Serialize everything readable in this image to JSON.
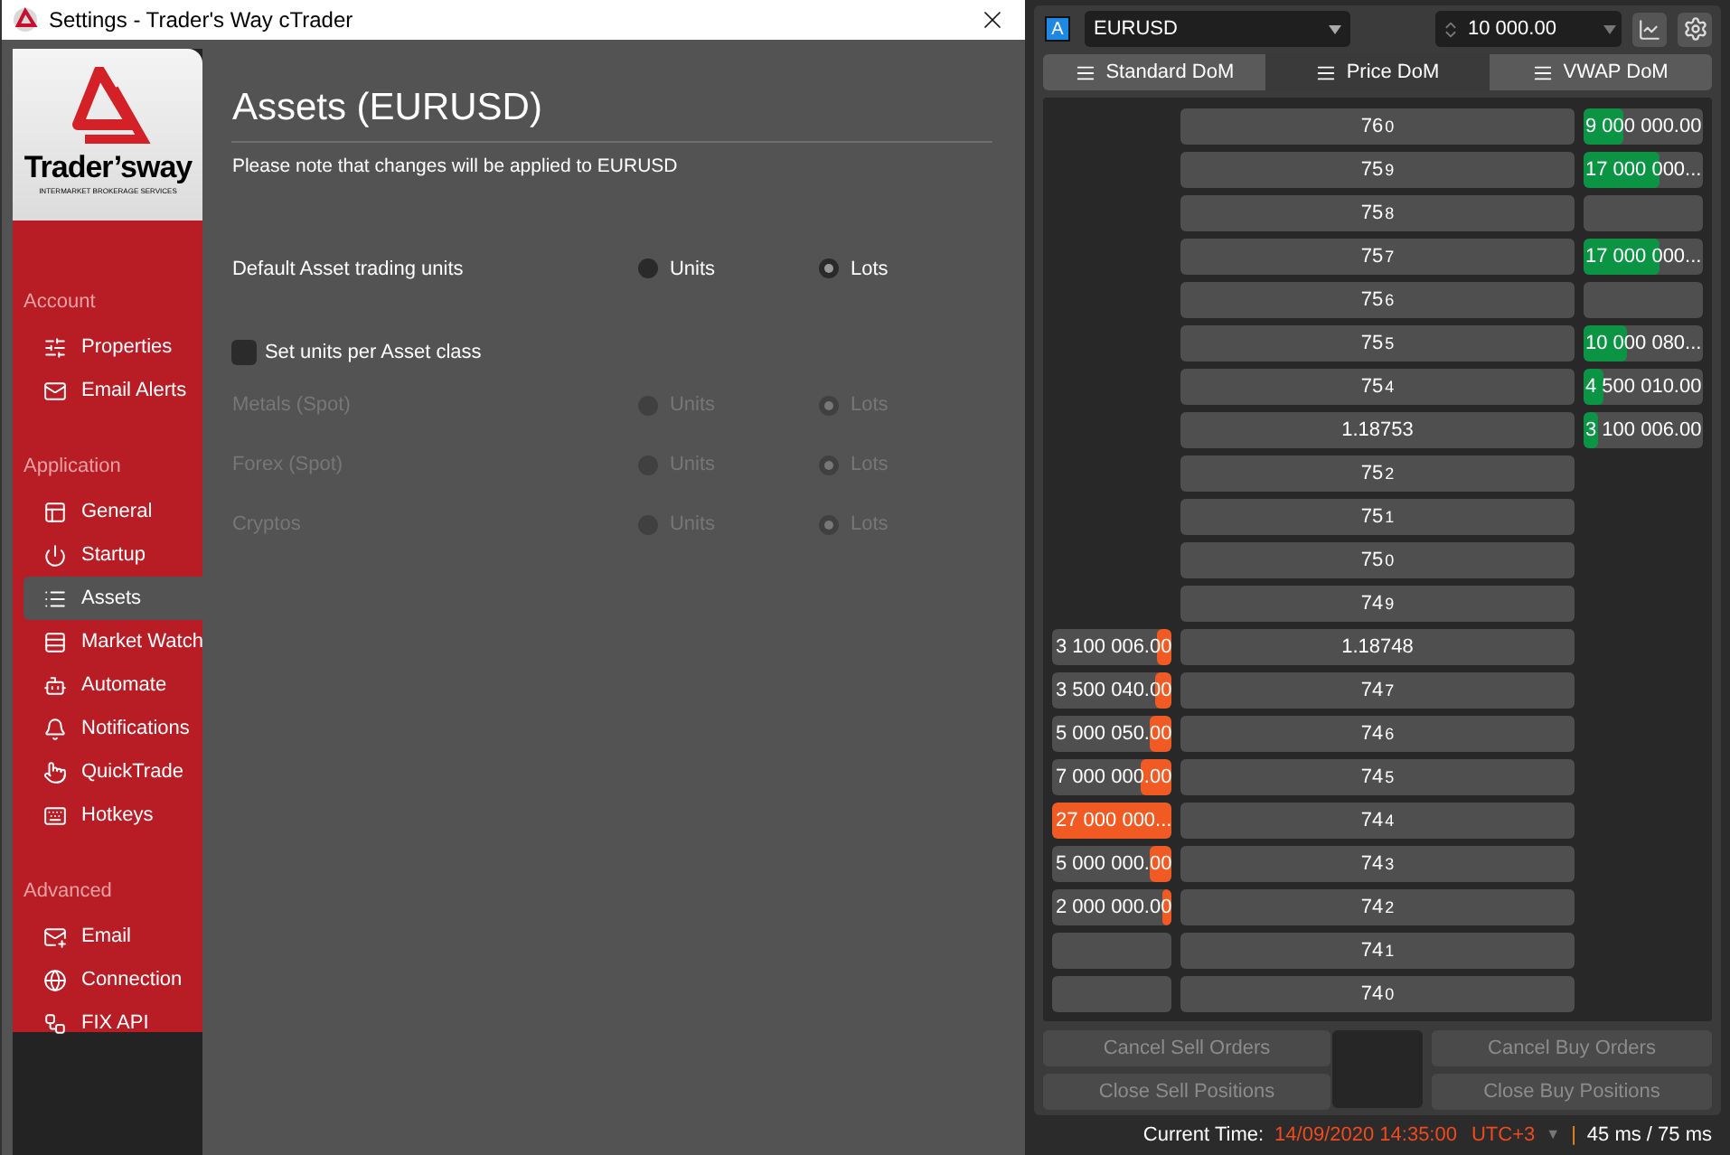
{
  "window": {
    "title": "Settings - Trader's Way cTrader"
  },
  "logo": {
    "name": "Trader’sway",
    "tagline": "INTERMARKET BROKERAGE SERVICES"
  },
  "sidebar": {
    "sections": [
      {
        "label": "Account",
        "items": [
          {
            "label": "Properties",
            "selected": false
          },
          {
            "label": "Email Alerts",
            "selected": false
          }
        ]
      },
      {
        "label": "Application",
        "items": [
          {
            "label": "General",
            "selected": false
          },
          {
            "label": "Startup",
            "selected": false
          },
          {
            "label": "Assets",
            "selected": true
          },
          {
            "label": "Market Watch",
            "selected": false
          },
          {
            "label": "Automate",
            "selected": false
          },
          {
            "label": "Notifications",
            "selected": false
          },
          {
            "label": "QuickTrade",
            "selected": false
          },
          {
            "label": "Hotkeys",
            "selected": false
          }
        ]
      },
      {
        "label": "Advanced",
        "items": [
          {
            "label": "Email",
            "selected": false
          },
          {
            "label": "Connection",
            "selected": false
          },
          {
            "label": "FIX API",
            "selected": false
          }
        ]
      }
    ]
  },
  "content": {
    "title": "Assets (EURUSD)",
    "note": "Please note that changes will be applied to EURUSD",
    "default_units": {
      "label": "Default Asset trading units",
      "disabled": false,
      "options": [
        {
          "label": "Units",
          "selected": false
        },
        {
          "label": "Lots",
          "selected": true
        }
      ]
    },
    "per_class": {
      "label": "Set units per Asset class",
      "checked": false
    },
    "classes": [
      {
        "label": "Metals (Spot)",
        "disabled": true,
        "options": [
          {
            "label": "Units",
            "selected": false
          },
          {
            "label": "Lots",
            "selected": true
          }
        ]
      },
      {
        "label": "Forex (Spot)",
        "disabled": true,
        "options": [
          {
            "label": "Units",
            "selected": false
          },
          {
            "label": "Lots",
            "selected": true
          }
        ]
      },
      {
        "label": "Cryptos",
        "disabled": true,
        "options": [
          {
            "label": "Units",
            "selected": false
          },
          {
            "label": "Lots",
            "selected": true
          }
        ]
      }
    ]
  },
  "dom": {
    "badge": "A",
    "symbol": "EURUSD",
    "quantity": "10 000.00",
    "tabs": [
      {
        "label": "Standard DoM",
        "selected": false
      },
      {
        "label": "Price DoM",
        "selected": true
      },
      {
        "label": "VWAP DoM",
        "selected": false
      }
    ],
    "rows": [
      {
        "price": "76",
        "pip": "0",
        "bid": {
          "kind": "volume",
          "text": "9 000 000.00",
          "level": 0.33
        }
      },
      {
        "price": "75",
        "pip": "9",
        "bid": {
          "kind": "volume",
          "text": "17 000 000...",
          "level": 0.63
        }
      },
      {
        "price": "75",
        "pip": "8",
        "bid": {
          "kind": "empty"
        }
      },
      {
        "price": "75",
        "pip": "7",
        "bid": {
          "kind": "volume",
          "text": "17 000 000...",
          "level": 0.63
        }
      },
      {
        "price": "75",
        "pip": "6",
        "bid": {
          "kind": "empty"
        }
      },
      {
        "price": "75",
        "pip": "5",
        "bid": {
          "kind": "volume",
          "text": "10 000 080...",
          "level": 0.36
        }
      },
      {
        "price": "75",
        "pip": "4",
        "bid": {
          "kind": "volume",
          "text": "4 500 010.00",
          "level": 0.17
        }
      },
      {
        "price": "1.18753",
        "bid": {
          "kind": "volume",
          "text": "3 100 006.00",
          "level": 0.12
        }
      },
      {
        "price": "75",
        "pip": "2"
      },
      {
        "price": "75",
        "pip": "1"
      },
      {
        "price": "75",
        "pip": "0"
      },
      {
        "price": "74",
        "pip": "9"
      },
      {
        "price": "1.18748",
        "ask": {
          "kind": "volume",
          "text": "3 100 006.00",
          "level": 0.12
        }
      },
      {
        "price": "74",
        "pip": "7",
        "ask": {
          "kind": "volume",
          "text": "3 500 040.00",
          "level": 0.13
        }
      },
      {
        "price": "74",
        "pip": "6",
        "ask": {
          "kind": "volume",
          "text": "5 000 050.00",
          "level": 0.18
        }
      },
      {
        "price": "74",
        "pip": "5",
        "ask": {
          "kind": "volume",
          "text": "7 000 000.00",
          "level": 0.26
        }
      },
      {
        "price": "74",
        "pip": "4",
        "ask": {
          "kind": "volume",
          "text": "27 000 000...",
          "level": 1
        }
      },
      {
        "price": "74",
        "pip": "3",
        "ask": {
          "kind": "volume",
          "text": "5 000 000.00",
          "level": 0.18
        }
      },
      {
        "price": "74",
        "pip": "2",
        "ask": {
          "kind": "volume",
          "text": "2 000 000.00",
          "level": 0.07
        }
      },
      {
        "price": "74",
        "pip": "1",
        "ask": {
          "kind": "empty"
        }
      },
      {
        "price": "74",
        "pip": "0",
        "ask": {
          "kind": "empty"
        }
      }
    ],
    "buttons": [
      {
        "label": "Cancel Sell Orders"
      },
      {
        "label": "Close Sell Positions"
      },
      {
        "label": "Cancel Buy Orders"
      },
      {
        "label": "Close Buy Positions"
      }
    ]
  },
  "status_bar": {
    "label": "Current Time:",
    "time": "14/09/2020 14:35:00",
    "timezone": "UTC+3",
    "caret": "▼",
    "separator": "|",
    "latency": "45 ms / 75 ms"
  }
}
